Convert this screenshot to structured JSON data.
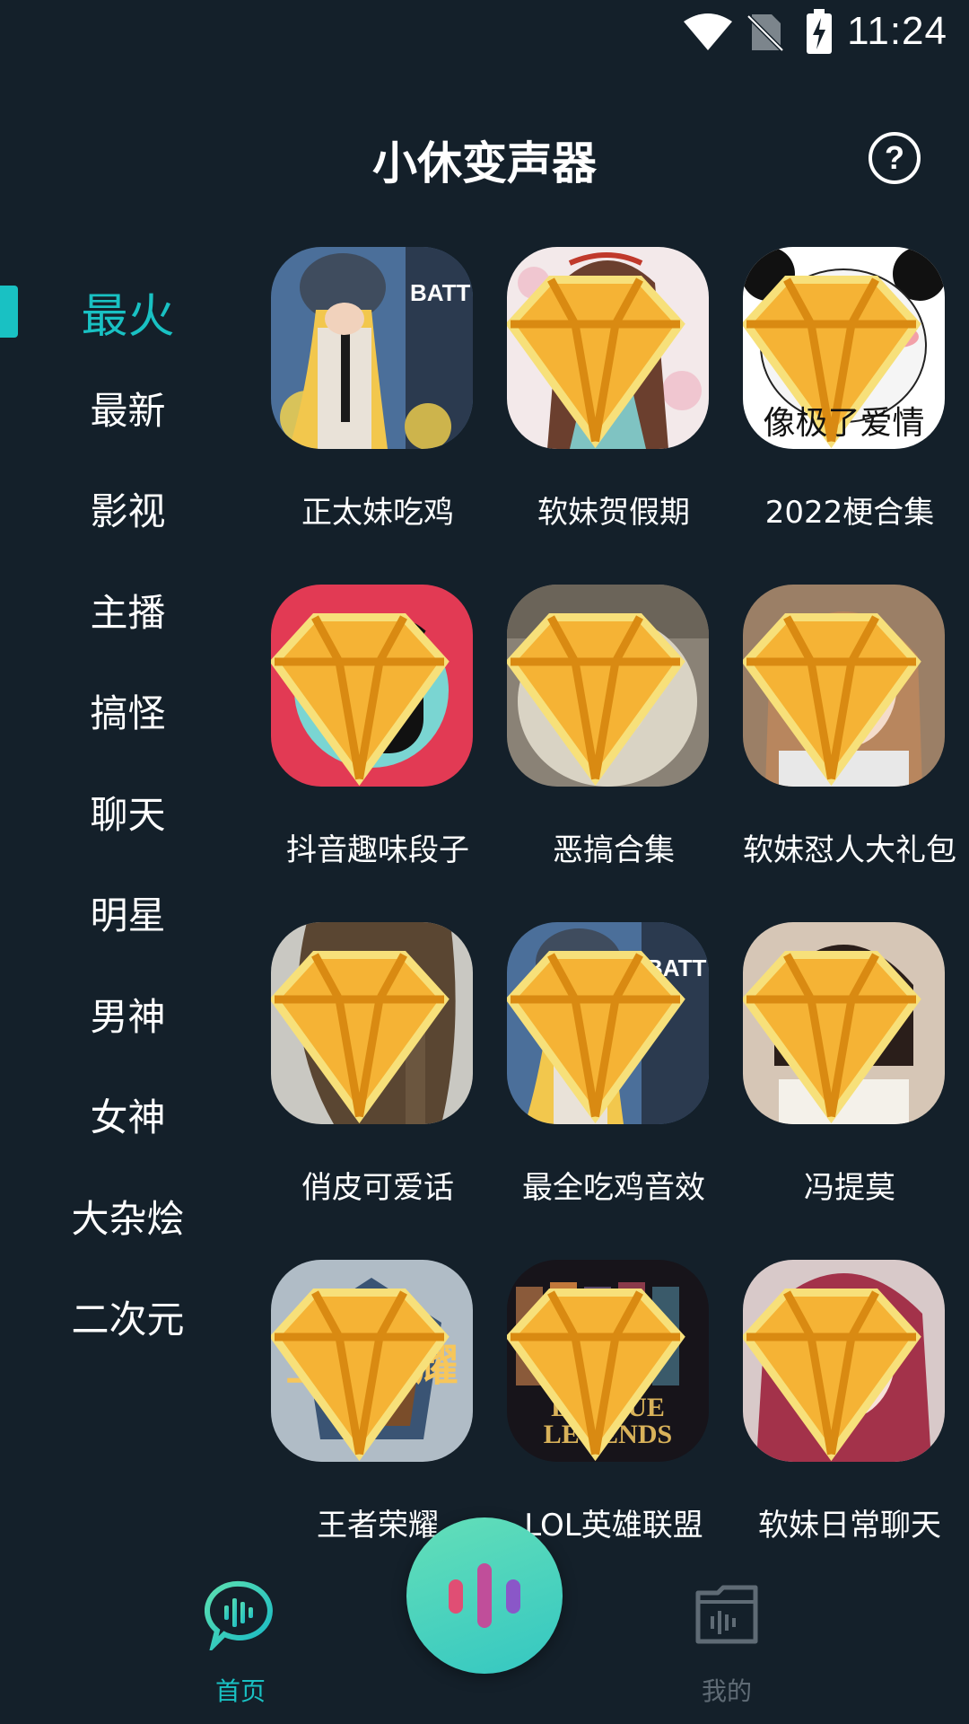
{
  "status": {
    "time": "11:24",
    "icons": [
      "wifi-icon",
      "no-sim-icon",
      "battery-charging-icon"
    ]
  },
  "header": {
    "title": "小休变声器",
    "help_icon": "help-icon",
    "help_glyph": "?"
  },
  "sidebar": {
    "active_index": 0,
    "accent": "#19c1c3",
    "items": [
      {
        "label": "最火"
      },
      {
        "label": "最新"
      },
      {
        "label": "影视"
      },
      {
        "label": "主播"
      },
      {
        "label": "搞怪"
      },
      {
        "label": "聊天"
      },
      {
        "label": "明星"
      },
      {
        "label": "男神"
      },
      {
        "label": "女神"
      },
      {
        "label": "大杂烩"
      },
      {
        "label": "二次元"
      }
    ]
  },
  "packs": [
    {
      "label": "正太妹吃鸡",
      "vip": false,
      "thumb": "pubg-girl"
    },
    {
      "label": "软妹贺假期",
      "vip": true,
      "thumb": "anime-girl"
    },
    {
      "label": "2022梗合集",
      "vip": true,
      "thumb": "panda-meme",
      "thumb_caption": "像极了爱情"
    },
    {
      "label": "抖音趣味段子",
      "vip": true,
      "thumb": "tiktok-mascot"
    },
    {
      "label": "恶搞合集",
      "vip": true,
      "thumb": "sheep"
    },
    {
      "label": "软妹怼人大礼包",
      "vip": true,
      "thumb": "girl-pout"
    },
    {
      "label": "俏皮可爱话",
      "vip": true,
      "thumb": "girl-braid"
    },
    {
      "label": "最全吃鸡音效",
      "vip": true,
      "thumb": "pubg-girl"
    },
    {
      "label": "冯提莫",
      "vip": true,
      "thumb": "girl-kiss"
    },
    {
      "label": "王者荣耀",
      "vip": true,
      "thumb": "king-glory-logo",
      "thumb_caption": "王者荣耀"
    },
    {
      "label": "LOL英雄联盟",
      "vip": true,
      "thumb": "league-legends",
      "thumb_caption": "LEAGUE LEGENDS"
    },
    {
      "label": "软妹日常聊天",
      "vip": true,
      "thumb": "girl-pink-hair"
    }
  ],
  "bottom_nav": {
    "home": {
      "label": "首页",
      "icon": "voice-chat-icon"
    },
    "record": {
      "icon": "audio-bars-icon"
    },
    "mine": {
      "label": "我的",
      "icon": "audio-folder-icon"
    }
  },
  "colors": {
    "background": "#14202a",
    "accent": "#19c1c3",
    "vip_gold": "#f5b335",
    "inactive_nav": "#5f6b75"
  }
}
